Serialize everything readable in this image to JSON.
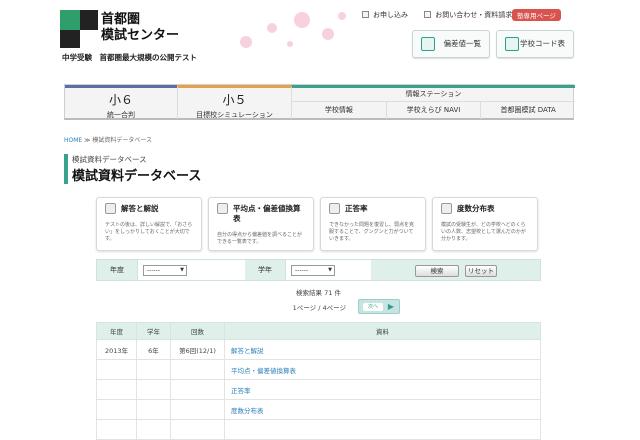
{
  "header": {
    "logo_line1": "首都圏",
    "logo_line2": "模試センター",
    "tagline": "中学受験　首都圏最大規模の公開テスト",
    "links": [
      "お申し込み",
      "お問い合わせ・資料請求"
    ],
    "member_label": "塾専用ページ",
    "btn_deviation": "偏差値一覧",
    "btn_school_code": "学校コード表"
  },
  "nav": {
    "g6_big": "小６",
    "g6_sub": "統一合判",
    "g5_big": "小５",
    "g5_sub": "目標校シミュレーション",
    "info_station": "情報ステーション",
    "info_items": [
      "学校情報",
      "学校えらび NAVI",
      "首都圏模試 DATA"
    ]
  },
  "breadcrumb": {
    "home": "HOME",
    "sep": "≫",
    "current": "模試資料データベース"
  },
  "page": {
    "subtitle": "模試資料データベース",
    "title": "模試資料データベース"
  },
  "cards": [
    {
      "title": "解答と解説",
      "desc": "テストの後は、詳しい解説で、「おさらい」をしっかりしておくことが大切です。"
    },
    {
      "title": "平均点・偏差値換算表",
      "desc": "自分の得点から偏差値を調べることができる一覧表です。"
    },
    {
      "title": "正答率",
      "desc": "できなかった問題を復習し、弱点を克服することで、グングンと力がついていきます。"
    },
    {
      "title": "度数分布表",
      "desc": "模試の受験生が、どの学校へどのくらいの人数、志望校として選んだのかが分かります。"
    }
  ],
  "filter": {
    "year_label": "年度",
    "year_value": "------",
    "grade_label": "学年",
    "grade_value": "------",
    "search_label": "検索",
    "reset_label": "リセット"
  },
  "results": {
    "count_text": "検索結果 71 件",
    "page_text": "1ページ / 4ページ",
    "next_label": "次へ"
  },
  "table": {
    "headers": [
      "年度",
      "学年",
      "回数",
      "資料"
    ],
    "first_row": {
      "year": "2013年",
      "grade": "6年",
      "round": "第6回(12/1)"
    },
    "materials": [
      "解答と解説",
      "平均点・偏差値換算表",
      "正答率",
      "度数分布表"
    ]
  },
  "colors": {
    "accent": "#3aa28c",
    "link": "#2b7fb8",
    "member": "#d9534f",
    "g6": "#5c6ea8",
    "g5": "#e3a24a"
  }
}
